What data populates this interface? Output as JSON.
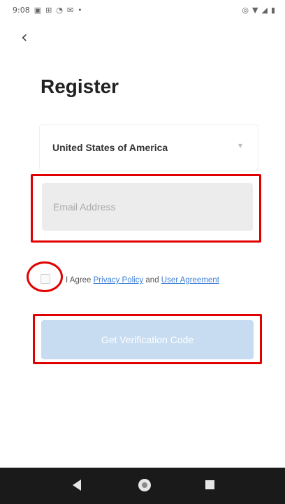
{
  "status_bar": {
    "time": "9:08",
    "left_icons": [
      "notification-icon",
      "grid-icon",
      "signal-icon",
      "mail-icon",
      "dot-icon"
    ],
    "right_icons": [
      "location-icon",
      "wifi-icon",
      "cellular-icon",
      "battery-icon"
    ]
  },
  "header": {
    "back_glyph": "‹"
  },
  "page": {
    "title": "Register"
  },
  "country": {
    "label": "United States of America",
    "chevron": "▾"
  },
  "email": {
    "placeholder": "Email Address",
    "value": ""
  },
  "agreement": {
    "prefix": "I Agree ",
    "privacy_link": "Privacy Policy",
    "connector": " and ",
    "user_link": "User Agreement",
    "checked": false
  },
  "cta": {
    "label": "Get Verification Code",
    "enabled": false
  },
  "nav_bar": {
    "icons": [
      "back-icon",
      "home-icon",
      "recents-icon"
    ]
  },
  "colors": {
    "highlight": "#e00000",
    "link": "#3b7fd6",
    "button_disabled": "#c7dcf1",
    "input_bg": "#ececec",
    "nav_bg": "#1a1a1a"
  }
}
